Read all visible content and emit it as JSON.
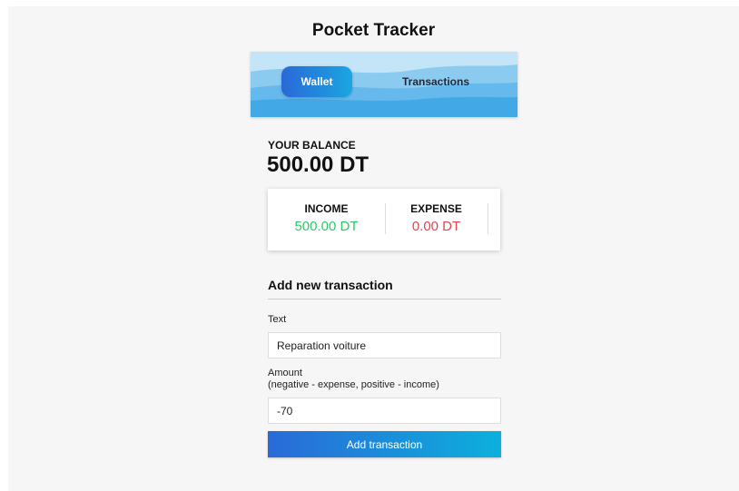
{
  "app": {
    "title": "Pocket Tracker"
  },
  "tabs": [
    {
      "label": "Wallet",
      "active": true
    },
    {
      "label": "Transactions",
      "active": false
    }
  ],
  "balance": {
    "label": "YOUR BALANCE",
    "value": "500.00 DT"
  },
  "summary": {
    "income_label": "INCOME",
    "income_value": "500.00 DT",
    "expense_label": "EXPENSE",
    "expense_value": "0.00 DT"
  },
  "form": {
    "title": "Add new transaction",
    "text_label": "Text",
    "text_value": "Reparation voiture",
    "amount_label": "Amount",
    "amount_hint": "(negative - expense, positive - income)",
    "amount_value": "-70",
    "submit_label": "Add transaction"
  },
  "colors": {
    "accent_start": "#2a6ad8",
    "accent_end": "#0cb0dc",
    "income": "#2ec866",
    "expense": "#e8424b",
    "page_background": "#f6f6f6"
  }
}
